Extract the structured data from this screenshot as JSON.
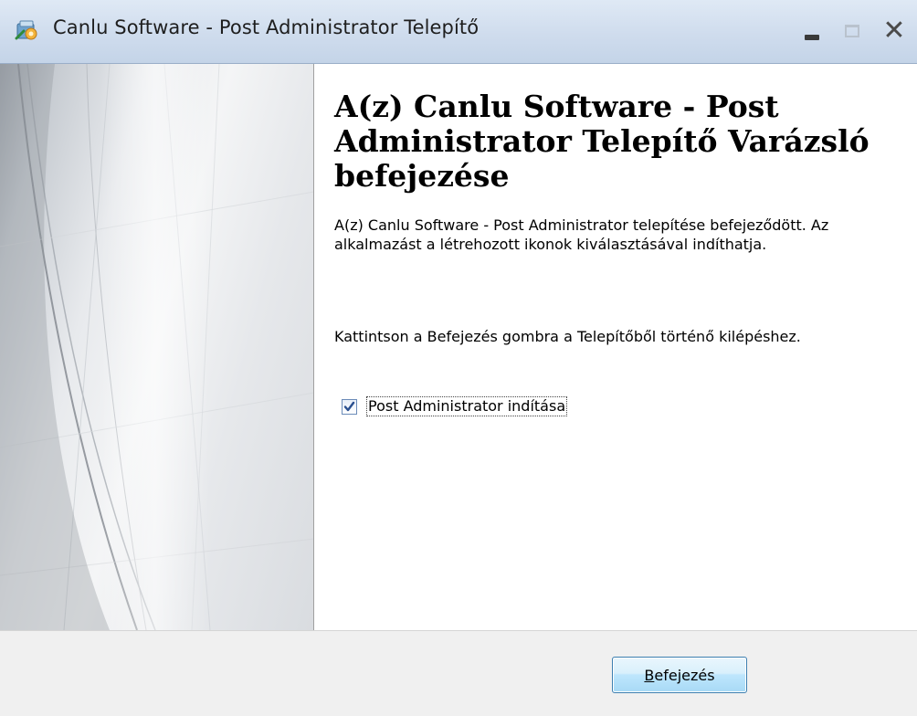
{
  "window": {
    "title": "Canlu Software - Post Administrator Telepítő",
    "controls": {
      "minimize_icon": "minimize-icon",
      "maximize_icon": "maximize-icon",
      "close_glyph": "✕"
    }
  },
  "content": {
    "heading": "A(z) Canlu Software - Post Administrator Telepítő Varázsló befejezése",
    "paragraph1": "A(z) Canlu Software - Post Administrator telepítése befejeződött. Az alkalmazást a létrehozott ikonok kiválasztásával indíthatja.",
    "paragraph2": "Kattintson a Befejezés gombra a Telepítőből történő kilépéshez.",
    "launch_checkbox": {
      "label": "Post Administrator indítása",
      "checked": true
    }
  },
  "footer": {
    "finish_button": {
      "accesskey": "B",
      "rest": "efejezés"
    }
  },
  "colors": {
    "accent": "#3c7fb1",
    "checkmark": "#2a4f8f"
  }
}
